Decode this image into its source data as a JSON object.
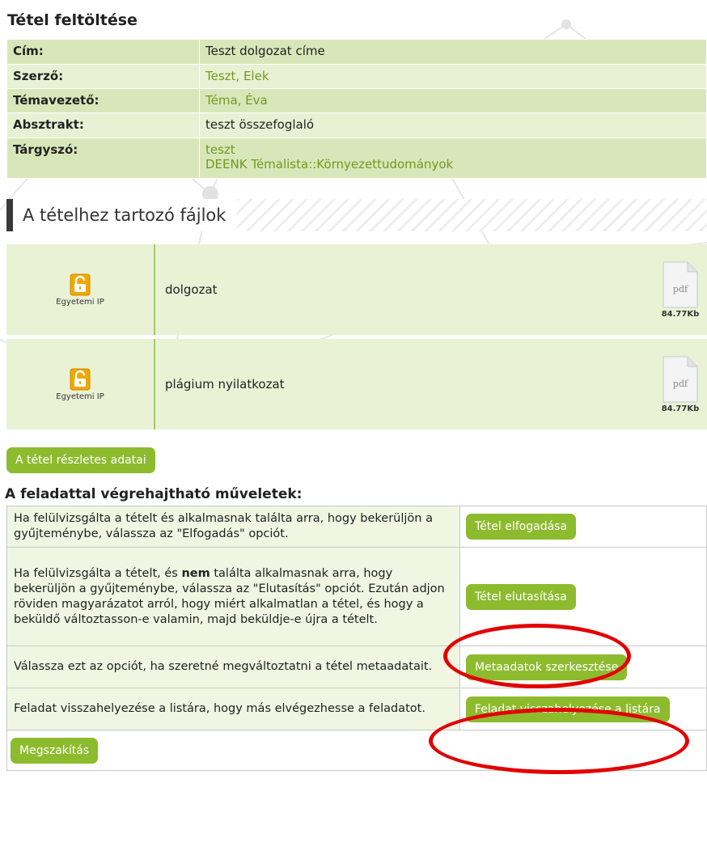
{
  "page": {
    "title": "Tétel feltöltése"
  },
  "metadata": {
    "rows": [
      {
        "key": "Cím:",
        "values": [
          "Teszt dolgozat címe"
        ],
        "link": false
      },
      {
        "key": "Szerző:",
        "values": [
          "Teszt, Elek"
        ],
        "link": true
      },
      {
        "key": "Témavezető:",
        "values": [
          "Téma, Éva"
        ],
        "link": true
      },
      {
        "key": "Absztrakt:",
        "values": [
          "teszt összefoglaló"
        ],
        "link": false
      },
      {
        "key": "Tárgyszó:",
        "values": [
          "teszt",
          "DEENK Témalista::Környezettudományok"
        ],
        "link": true
      }
    ]
  },
  "files_section": {
    "heading": "A tételhez tartozó fájlok",
    "files": [
      {
        "access_label": "Egyetemi IP",
        "name": "dolgozat",
        "type": "pdf",
        "size": "84.77Kb",
        "icon": "lock-open-icon"
      },
      {
        "access_label": "Egyetemi IP",
        "name": "plágium nyilatkozat",
        "type": "pdf",
        "size": "84.77Kb",
        "icon": "lock-open-icon"
      }
    ]
  },
  "details_button": "A tétel részletes adatai",
  "operations": {
    "heading": "A feladattal végrehajtható műveletek:",
    "rows": [
      {
        "desc": "Ha felülvizsgálta a tételt és alkalmasnak találta arra, hogy bekerüljön a gyűjteménybe, válassza az \"Elfogadás\" opciót.",
        "button": "Tétel elfogadása"
      },
      {
        "desc_before": "Ha felülvizsgálta a tételt, és ",
        "desc_bold": "nem",
        "desc_after": " találta alkalmasnak arra, hogy bekerüljön a gyűjteménybe, válassza az \"Elutasítás\" opciót. Ezután adjon röviden magyarázatot arról, hogy miért alkalmatlan a tétel, és hogy a beküldő változtasson-e valamin, majd beküldje-e újra a tételt.",
        "button": "Tétel elutasítása"
      },
      {
        "desc": "Válassza ezt az opciót, ha szeretné megváltoztatni a tétel metaadatait.",
        "button": "Metaadatok szerkesztése"
      },
      {
        "desc": "Feladat visszahelyezése a listára, hogy más elvégezhesse a feladatot.",
        "button": "Feladat visszahelyezése a listára"
      }
    ],
    "cancel_button": "Megszakítás"
  },
  "colors": {
    "button_green": "#8dbb2e",
    "table_green_light": "#e8f1d3",
    "table_green_dark": "#d8e7b9",
    "link_green": "#6f9a22",
    "annotation_red": "#e30000"
  }
}
